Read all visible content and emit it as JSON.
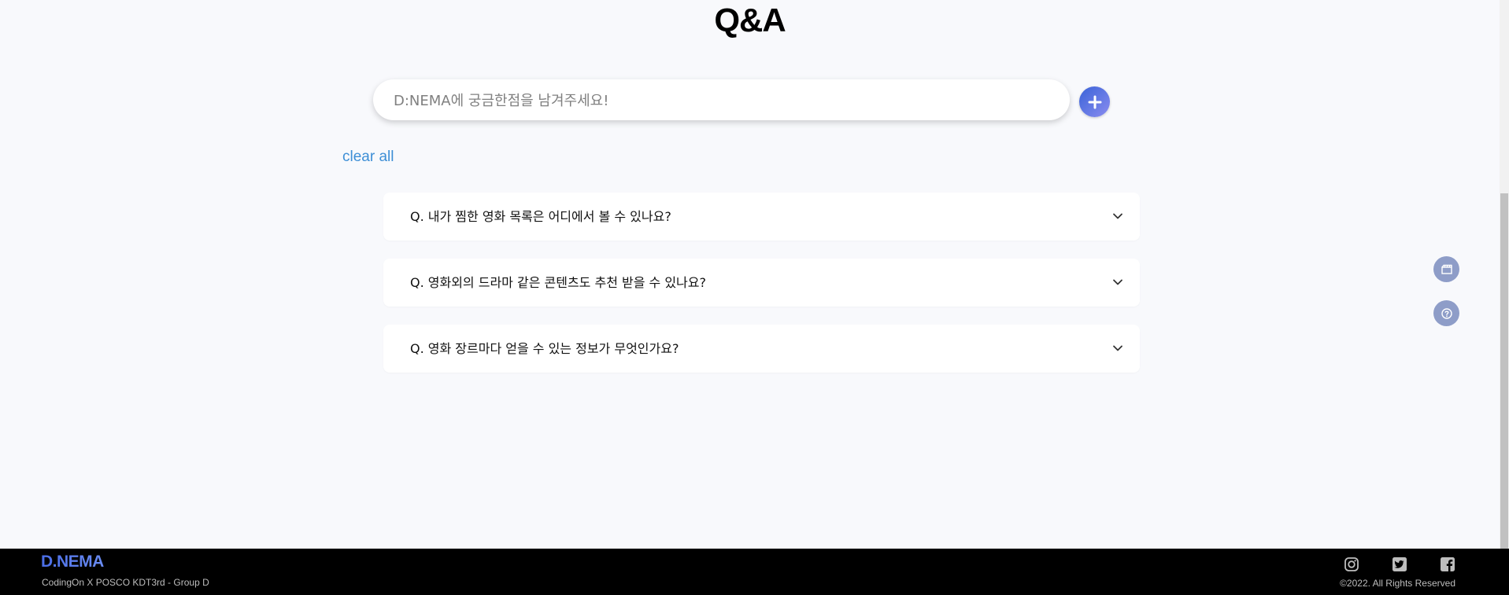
{
  "page": {
    "title": "Q&A"
  },
  "question_input": {
    "placeholder": "D:NEMA에 궁금한점을 남겨주세요!",
    "value": ""
  },
  "add_button": {
    "icon": "plus-icon"
  },
  "clear_all_label": "clear all",
  "faq_items": [
    {
      "question": "Q. 내가 찜한 영화 목록은 어디에서 볼 수 있나요?",
      "icon": "chevron-down-icon"
    },
    {
      "question": "Q. 영화외의 드라마 같은 콘텐츠도 추천 받을 수 있나요?",
      "icon": "chevron-down-icon"
    },
    {
      "question": "Q. 영화 장르마다 얻을 수 있는 정보가 무엇인가요?",
      "icon": "chevron-down-icon"
    }
  ],
  "side_buttons": [
    {
      "icon": "movie-clapper-icon"
    },
    {
      "icon": "help-circle-icon"
    }
  ],
  "footer": {
    "logo": "D.NEMA",
    "subtitle": "CodingOn X POSCO KDT3rd - Group D",
    "copyright": "©2022. All Rights Reserved",
    "social_icons": [
      "instagram-icon",
      "twitter-icon",
      "facebook-icon"
    ]
  },
  "colors": {
    "background": "#f8f9fc",
    "accent_link": "#3e8fd6",
    "add_button_gradient": [
      "#3a63d8",
      "#8a8cf0"
    ],
    "side_button": "#8e9dc8",
    "footer_bg": "#000000",
    "footer_text": "#bdbdbd"
  }
}
